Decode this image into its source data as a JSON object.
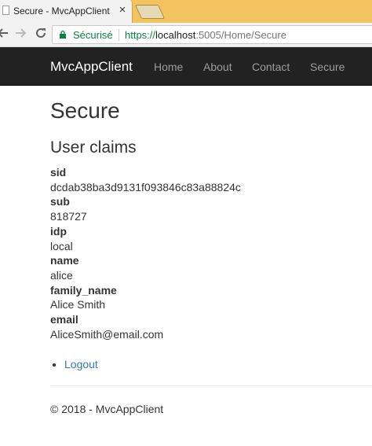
{
  "browser": {
    "tab_title": "Secure - MvcAppClient",
    "close_glyph": "×",
    "secure_label": "Sécurisé",
    "url_protocol": "https://",
    "url_host": "localhost",
    "url_path": ":5005/Home/Secure"
  },
  "navbar": {
    "brand": "MvcAppClient",
    "links": [
      "Home",
      "About",
      "Contact",
      "Secure"
    ]
  },
  "page": {
    "title": "Secure",
    "subtitle": "User claims",
    "claims": [
      {
        "type": "sid",
        "value": "dcdab38ba3d9131f093846c83a88824c"
      },
      {
        "type": "sub",
        "value": "818727"
      },
      {
        "type": "idp",
        "value": "local"
      },
      {
        "type": "name",
        "value": "alice"
      },
      {
        "type": "family_name",
        "value": "Alice Smith"
      },
      {
        "type": "email",
        "value": "AliceSmith@email.com"
      }
    ],
    "logout_label": "Logout",
    "footer": "© 2018 - MvcAppClient"
  },
  "colors": {
    "tabstrip": "#f2c35e",
    "navbar": "#222222",
    "link": "#337ab7",
    "secure_green": "#0b8043"
  }
}
